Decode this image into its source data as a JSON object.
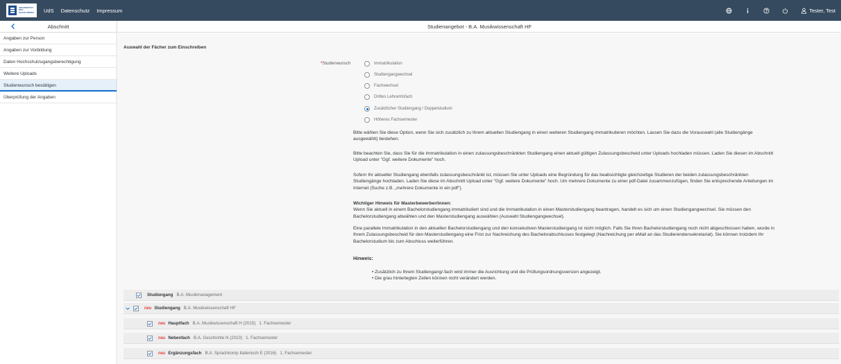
{
  "topbar": {
    "logo_lines": [
      "UNIVERSITÄT",
      "DES",
      "SAARLANDES"
    ],
    "links": [
      "UdS",
      "Datenschutz",
      "Impressum"
    ],
    "user": "Tester, Test",
    "icons": [
      "globe-icon",
      "info-icon",
      "help-icon",
      "power-icon",
      "user-icon"
    ]
  },
  "sidebar": {
    "title": "Abschnitt",
    "items": [
      {
        "label": "Angaben zur Person"
      },
      {
        "label": "Angaben zur Vorbildung"
      },
      {
        "label": "Daten Hochschulzugangsberechtigung"
      },
      {
        "label": "Weitere Uploads"
      },
      {
        "label": "Studienwunsch bestätigen",
        "active": true
      },
      {
        "label": "Überprüfung der Angaben"
      }
    ]
  },
  "main": {
    "title": "Studienangebot - B.A. Musikwissenschaft HF",
    "section_title": "Auswahl der Fächer zum Einschreiben",
    "field_label": "Studienwunsch",
    "required_marker": "*",
    "options": [
      {
        "label": "Immatrikulation",
        "checked": false
      },
      {
        "label": "Studiengangwechsel",
        "checked": false
      },
      {
        "label": "Fachwechsel",
        "checked": false
      },
      {
        "label": "Drittes Lehramtsfach",
        "checked": false
      },
      {
        "label": "Zusätzlicher Studiengang / Doppelstudium",
        "checked": true
      },
      {
        "label": "Höheres Fachsemester",
        "checked": false
      }
    ],
    "paragraphs": {
      "p1": "Bitte wählen Sie diese Option, wenn Sie sich zusätzlich zu Ihrem aktuellen Studiengang in einen weiteren Studiengang immatrikulieren möchten. Lassen Sie dazu die Vorauswahl (alle Studiengänge ausgewählt) bestehen.",
      "p2": "Bitte beachten Sie, dass Sie für die Immatrikulation in einen zulassungsbeschränkten Studiengang einen aktuell gültigen Zulassungsbescheid unter Uploads hochladen müssen. Laden Sie diesen im Abschnitt Upload unter \"Ggf. weitere Dokumente\" hoch.",
      "p3": "Sofern Ihr aktueller Studiengang ebenfalls zulassungsbeschränkt ist, müssen Sie unter Uploads eine Begründung für das beabsichtigte gleichzeitige Studieren der beiden zulassungsbeschränkten Studiengänge hochladen. Laden Sie diese im Abschnitt Upload unter \"Ggf. weitere Dokumente\" hoch. Um mehrere Dokumente zu einer pdf-Datei zusammenzufügen, finden Sie entsprechende Anleitungen im Internet (Suche z.B. „mehrere Dokumente in ein pdf\").",
      "p4_title": "Wichtiger Hinweis für Masterbewerber/innen:",
      "p4": "Wenn Sie aktuell in einem Bachelorstudiengang immatrikuliert sind und die Immatrikulation in einen Masterstudiengang beantragen, handelt es sich um einen Studiengangwechsel. Sie müssen den Bachelorstudiengang abwählen und den Masterstudiengang auswählen (Auswahl Studiengangwechsel).",
      "p5": "Eine parallele Immatrikulation in den aktuellen Bachelorstudiengang und den konsekutiven Masterstudiengang ist nicht möglich. Falls Sie Ihren Bachelorstudiengang noch nicht abgeschlossen haben, wurde in Ihrem Zulassungsbescheid für den Masterstudiengang eine Frist zur Nachreichung des Bachelorabschlusses festgelegt (Nachreichung per eMail an das Studierendensekretariat). Sie können trotzdem Ihr Bachelorstudium bis zum Abschluss weiterführen."
    },
    "hint_title": "Hinweis:",
    "hints": [
      "Zusätzlich zu Ihrem Studiengang/-fach wird immer die Ausrichtung und die Prüfungsordnungsversion angezeigt.",
      "Die grau hinterlegten Zeilen können nicht verändert werden."
    ],
    "rows": [
      {
        "expander": false,
        "indent": false,
        "neu": "",
        "label": "Studiengang",
        "value": "B.A. Musikmanagement",
        "semester": ""
      },
      {
        "expander": true,
        "indent": false,
        "neu": "neu",
        "label": "Studiengang",
        "value": "B.A. Musikwissenschaft HF",
        "semester": ""
      },
      {
        "expander": false,
        "indent": true,
        "neu": "neu",
        "label": "Hauptfach",
        "value": "B.A. Musikwissenschaft H (2015)",
        "semester": "1. Fachsemester"
      },
      {
        "expander": false,
        "indent": true,
        "neu": "neu",
        "label": "Nebenfach",
        "value": "B.A. Geschichte N (2010)",
        "semester": "1. Fachsemester"
      },
      {
        "expander": false,
        "indent": true,
        "neu": "neu",
        "label": "Ergänzungsfach",
        "value": "B.A. Sprachkomp Italienisch E (2016)",
        "semester": "1. Fachsemester"
      }
    ]
  }
}
